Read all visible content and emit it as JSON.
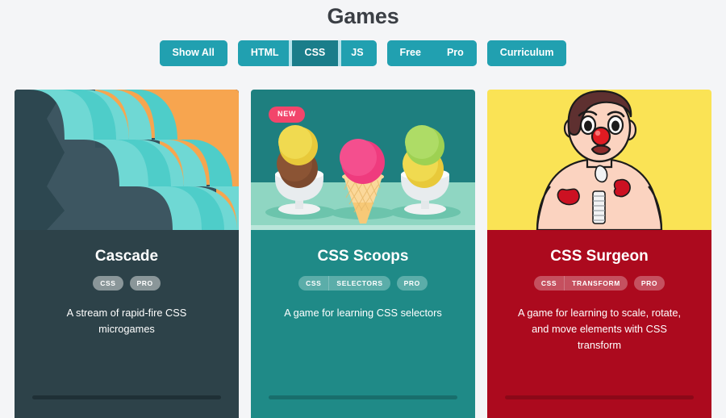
{
  "header": {
    "title": "Games"
  },
  "filters": {
    "groups": [
      {
        "name": "show-all",
        "buttons": [
          {
            "label": "Show All",
            "active": false
          }
        ]
      },
      {
        "name": "language",
        "buttons": [
          {
            "label": "HTML",
            "active": false
          },
          {
            "label": "CSS",
            "active": true
          },
          {
            "label": "JS",
            "active": false
          }
        ]
      },
      {
        "name": "pricing",
        "buttons": [
          {
            "label": "Free",
            "active": false
          },
          {
            "label": "Pro",
            "active": false
          }
        ]
      },
      {
        "name": "curriculum",
        "buttons": [
          {
            "label": "Curriculum",
            "active": false
          }
        ]
      }
    ]
  },
  "cards": [
    {
      "id": "cascade",
      "title": "Cascade",
      "tags": [
        "CSS",
        "PRO"
      ],
      "tag_groups": [
        [
          "CSS"
        ],
        [
          "PRO"
        ]
      ],
      "description": "A stream of rapid-fire CSS microgames",
      "badge": null,
      "art": "waterfall-illustration",
      "colors": {
        "body": "#2d4249",
        "art_background": "#f5a košt"
      }
    },
    {
      "id": "css-scoops",
      "title": "CSS Scoops",
      "tags": [
        "CSS",
        "SELECTORS",
        "PRO"
      ],
      "tag_groups": [
        [
          "CSS",
          "SELECTORS"
        ],
        [
          "PRO"
        ]
      ],
      "description": "A game for learning CSS selectors",
      "badge": "NEW",
      "art": "ice-cream-illustration",
      "colors": {
        "body": "#1f8a87",
        "art_background": "#1e7f7f"
      }
    },
    {
      "id": "css-surgeon",
      "title": "CSS Surgeon",
      "tags": [
        "CSS",
        "TRANSFORM",
        "PRO"
      ],
      "tag_groups": [
        [
          "CSS",
          "TRANSFORM"
        ],
        [
          "PRO"
        ]
      ],
      "description": "A game for learning to scale, rotate, and move elements with CSS transform",
      "badge": null,
      "art": "clown-patient-illustration",
      "colors": {
        "body": "#ac0a1e",
        "art_background": "#fae355"
      }
    }
  ],
  "theme": {
    "page_background": "#f4f5f7",
    "accent": "#21a0b0",
    "accent_active": "#1a7d8a",
    "accent_glow": "#b6e3ec",
    "badge": "#f2456b",
    "title_color": "#3b3f45"
  }
}
